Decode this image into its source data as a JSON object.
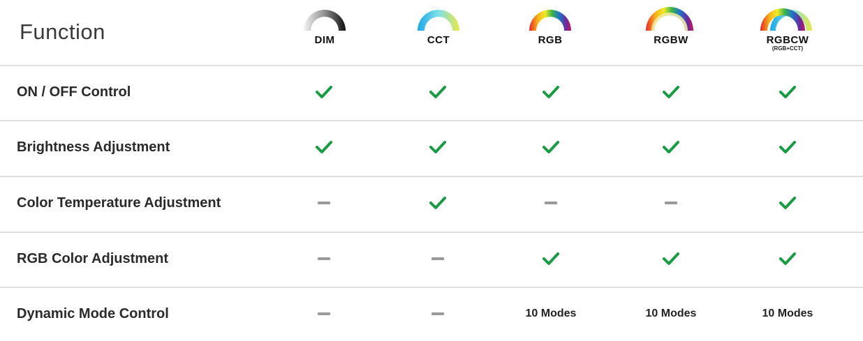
{
  "header": {
    "function_label": "Function"
  },
  "columns": [
    {
      "label": "DIM",
      "sublabel": "",
      "icon": "dim-arc-icon"
    },
    {
      "label": "CCT",
      "sublabel": "",
      "icon": "cct-arc-icon"
    },
    {
      "label": "RGB",
      "sublabel": "",
      "icon": "rgb-arc-icon"
    },
    {
      "label": "RGBW",
      "sublabel": "",
      "icon": "rgbw-arc-icon"
    },
    {
      "label": "RGBCW",
      "sublabel": "(RGB+CCT)",
      "icon": "rgbcw-arc-icon"
    }
  ],
  "rows": [
    {
      "label": "ON / OFF Control",
      "cells": [
        {
          "type": "check"
        },
        {
          "type": "check"
        },
        {
          "type": "check"
        },
        {
          "type": "check"
        },
        {
          "type": "check"
        }
      ]
    },
    {
      "label": "Brightness Adjustment",
      "cells": [
        {
          "type": "check"
        },
        {
          "type": "check"
        },
        {
          "type": "check"
        },
        {
          "type": "check"
        },
        {
          "type": "check"
        }
      ]
    },
    {
      "label": "Color Temperature Adjustment",
      "cells": [
        {
          "type": "dash"
        },
        {
          "type": "check"
        },
        {
          "type": "dash"
        },
        {
          "type": "dash"
        },
        {
          "type": "check"
        }
      ]
    },
    {
      "label": "RGB Color Adjustment",
      "cells": [
        {
          "type": "dash"
        },
        {
          "type": "dash"
        },
        {
          "type": "check"
        },
        {
          "type": "check"
        },
        {
          "type": "check"
        }
      ]
    },
    {
      "label": "Dynamic Mode Control",
      "cells": [
        {
          "type": "dash"
        },
        {
          "type": "dash"
        },
        {
          "type": "text",
          "text": "10 Modes"
        },
        {
          "type": "text",
          "text": "10 Modes"
        },
        {
          "type": "text",
          "text": "10 Modes"
        }
      ]
    }
  ],
  "colors": {
    "check": "#1a9a45",
    "dash": "#9a9a9a",
    "divider": "#e0e0e0"
  }
}
